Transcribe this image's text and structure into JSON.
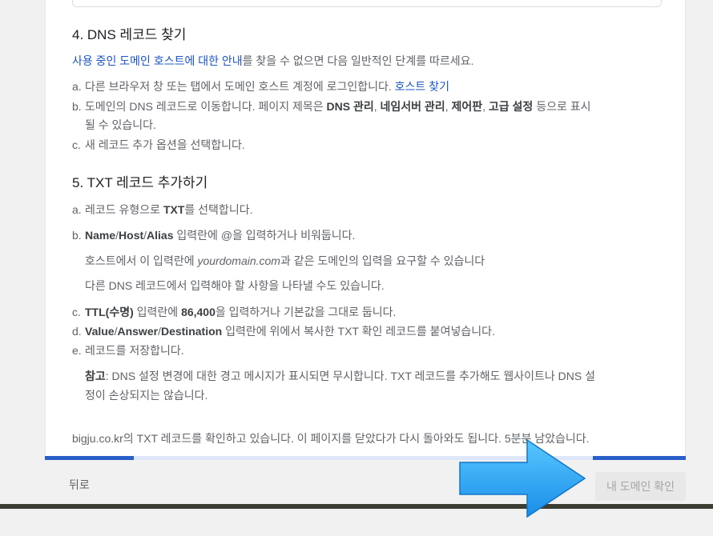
{
  "section4": {
    "heading": "4. DNS 레코드 찾기",
    "intro_link": "사용 중인 도메인 호스트에 대한 안내",
    "intro_rest": "를 찾을 수 없으면 다음 일반적인 단계를 따르세요.",
    "steps": {
      "a_marker": "a.",
      "a_text": "다른 브라우저 창 또는 탭에서 도메인 호스트 계정에 로그인합니다.",
      "a_link": "호스트 찾기",
      "b_marker": "b.",
      "b_text1": "도메인의 DNS 레코드로 이동합니다. 페이지 제목은 ",
      "b_bold1": "DNS 관리",
      "b_sep1": ", ",
      "b_bold2": "네임서버 관리",
      "b_sep2": ", ",
      "b_bold3": "제어판",
      "b_sep3": ", ",
      "b_bold4": "고급 설정",
      "b_text2": " 등으로 표시",
      "b_text3": "될 수 있습니다.",
      "c_marker": "c.",
      "c_text": "새 레코드 추가 옵션을 선택합니다."
    }
  },
  "section5": {
    "heading": "5. TXT 레코드 추가하기",
    "a_marker": "a.",
    "a_text1": "레코드 유형으로 ",
    "a_bold": "TXT",
    "a_text2": "를 선택합니다.",
    "b_marker": "b.",
    "b_bold1": "Name",
    "b_slash1": "/",
    "b_bold2": "Host",
    "b_slash2": "/",
    "b_bold3": "Alias",
    "b_text": " 입력란에 @을 입력하거나 비워둡니다.",
    "b_note1_pre": "호스트에서 이 입력란에 ",
    "b_note1_italic": "yourdomain.com",
    "b_note1_post": "과 같은 도메인의 입력을 요구할 수 있습니다",
    "b_note2": "다른 DNS 레코드에서 입력해야 할 사항을 나타낼 수도 있습니다.",
    "c_marker": "c.",
    "c_bold1": "TTL(수명)",
    "c_text1": " 입력란에 ",
    "c_bold2": "86,400",
    "c_text2": "을 입력하거나 기본값을 그대로 둡니다.",
    "d_marker": "d.",
    "d_bold1": "Value",
    "d_slash1": "/",
    "d_bold2": "Answer",
    "d_slash2": "/",
    "d_bold3": "Destination",
    "d_text": " 입력란에 위에서 복사한 TXT 확인 레코드를 붙여넣습니다.",
    "e_marker": "e.",
    "e_text": "레코드를 저장합니다.",
    "note_bold": "참고",
    "note_text1": ": DNS 설정 변경에 대한 경고 메시지가 표시되면 무시합니다. TXT 레코드를 추가해도 웹사이트나 DNS 설",
    "note_text2": "정이 손상되지는 않습니다."
  },
  "status_text": "bigju.co.kr의 TXT 레코드를 확인하고 있습니다. 이 페이지를 닫았다가 다시 돌아와도 됩니다. 5분분 남았습니다.",
  "footer": {
    "back_label": "뒤로",
    "confirm_label": "내 도메인 확인"
  },
  "colors": {
    "link": "#1a55c7",
    "progress": "#2a5ec9",
    "arrow": "#2aa7f5"
  },
  "icons": [
    "arrow-pointer-icon"
  ]
}
